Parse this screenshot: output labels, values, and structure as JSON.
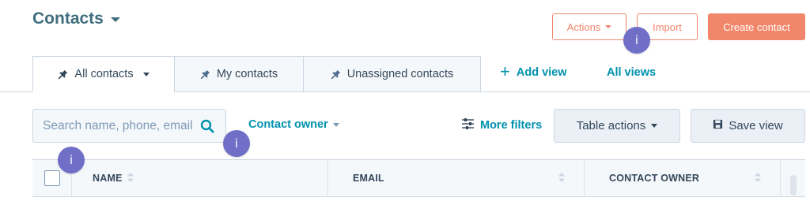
{
  "header": {
    "title": "Contacts",
    "actions_label": "Actions",
    "import_label": "Import",
    "create_label": "Create contact"
  },
  "badges": {
    "info_glyph": "i"
  },
  "tabs": [
    {
      "label": "All contacts",
      "active": true
    },
    {
      "label": "My contacts",
      "active": false
    },
    {
      "label": "Unassigned contacts",
      "active": false
    }
  ],
  "view_links": {
    "add_view": "Add view",
    "all_views": "All views"
  },
  "filters": {
    "search_placeholder": "Search name, phone, email",
    "contact_owner": "Contact owner",
    "more_filters": "More filters",
    "table_actions": "Table actions",
    "save_view": "Save view"
  },
  "table": {
    "columns": [
      "NAME",
      "EMAIL",
      "CONTACT OWNER"
    ]
  },
  "colors": {
    "accent": "#f2866a",
    "link": "#0091ae",
    "title": "#3f6f7e",
    "badge": "#6f6fc8"
  },
  "icons": {
    "title_caret": "chevron-down-icon",
    "pin": "pin-icon",
    "plus": "plus-icon",
    "search": "search-icon",
    "filters": "sliders-icon",
    "save": "floppy-disk-icon",
    "sort": "sort-icon"
  }
}
